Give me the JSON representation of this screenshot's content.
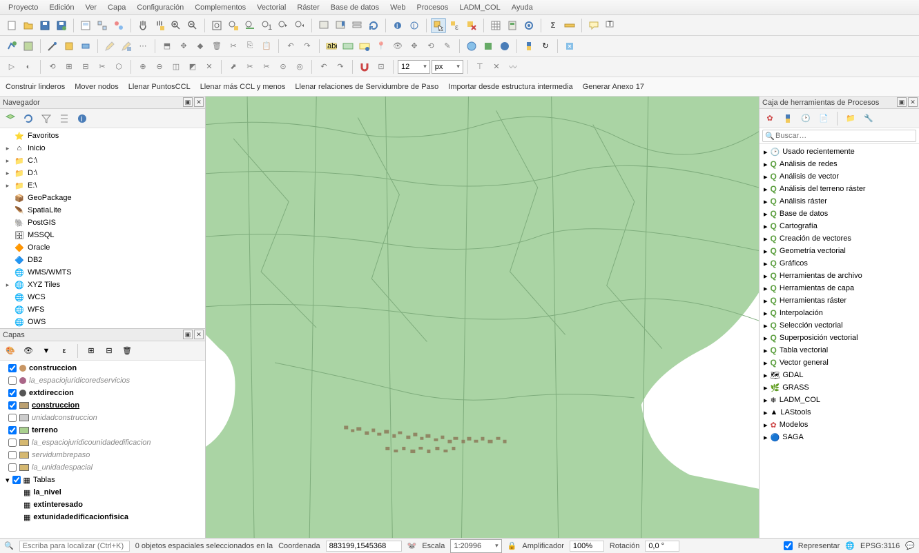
{
  "menu": [
    "Proyecto",
    "Edición",
    "Ver",
    "Capa",
    "Configuración",
    "Complementos",
    "Vectorial",
    "Ráster",
    "Base de datos",
    "Web",
    "Procesos",
    "LADM_COL",
    "Ayuda"
  ],
  "actions": [
    "Construir linderos",
    "Mover nodos",
    "Llenar PuntosCCL",
    "Llenar más CCL y menos",
    "Llenar relaciones de Servidumbre de Paso",
    "Importar desde estructura intermedia",
    "Generar Anexo 17"
  ],
  "snap_value": "12",
  "snap_unit": "px",
  "navegador": {
    "title": "Navegador",
    "items": [
      {
        "label": "Favoritos",
        "icon": "star",
        "color": "#f2c200"
      },
      {
        "label": "Inicio",
        "icon": "home",
        "arrow": true
      },
      {
        "label": "C:\\",
        "icon": "folder",
        "arrow": true
      },
      {
        "label": "D:\\",
        "icon": "folder",
        "arrow": true
      },
      {
        "label": "E:\\",
        "icon": "folder",
        "arrow": true
      },
      {
        "label": "GeoPackage",
        "icon": "geopkg"
      },
      {
        "label": "SpatiaLite",
        "icon": "feather"
      },
      {
        "label": "PostGIS",
        "icon": "elephant"
      },
      {
        "label": "MSSQL",
        "icon": "mssql"
      },
      {
        "label": "Oracle",
        "icon": "oracle"
      },
      {
        "label": "DB2",
        "icon": "db2"
      },
      {
        "label": "WMS/WMTS",
        "icon": "globe"
      },
      {
        "label": "XYZ Tiles",
        "icon": "globe",
        "arrow": true
      },
      {
        "label": "WCS",
        "icon": "globe"
      },
      {
        "label": "WFS",
        "icon": "globe"
      },
      {
        "label": "OWS",
        "icon": "globe"
      }
    ]
  },
  "capas": {
    "title": "Capas",
    "items": [
      {
        "checked": true,
        "label": "construccion",
        "bold": true,
        "swatch": "#c89664",
        "style": "point"
      },
      {
        "checked": false,
        "label": "la_espaciojuridicoredservicios",
        "italic": true,
        "swatch": "#aa6688",
        "style": "point"
      },
      {
        "checked": true,
        "label": "extdireccion",
        "bold": true,
        "swatch": "#555",
        "style": "point"
      },
      {
        "checked": true,
        "label": "construccion",
        "bold": true,
        "underline": true,
        "swatch": "#bba070",
        "style": "square"
      },
      {
        "checked": false,
        "label": "unidadconstruccion",
        "italic": true,
        "swatch": "#ccc",
        "style": "square"
      },
      {
        "checked": true,
        "label": "terreno",
        "bold": true,
        "swatch": "#a9d08e",
        "style": "square"
      },
      {
        "checked": false,
        "label": "la_espaciojuridicounidadedificacion",
        "italic": true,
        "swatch": "#d5b870",
        "style": "square"
      },
      {
        "checked": false,
        "label": "servidumbrepaso",
        "italic": true,
        "swatch": "#d5b870",
        "style": "square"
      },
      {
        "checked": false,
        "label": "la_unidadespacial",
        "italic": true,
        "swatch": "#d5b870",
        "style": "square"
      }
    ],
    "tablas_label": "Tablas",
    "tablas": [
      "la_nivel",
      "extinteresado",
      "extunidadedificacionfisica"
    ]
  },
  "procesos": {
    "title": "Caja de herramientas de Procesos",
    "search_placeholder": "Buscar…",
    "groups": [
      {
        "label": "Usado recientemente",
        "icon": "clock"
      },
      {
        "label": "Análisis de redes",
        "icon": "q"
      },
      {
        "label": "Análisis de vector",
        "icon": "q"
      },
      {
        "label": "Análisis del terreno ráster",
        "icon": "q"
      },
      {
        "label": "Análisis ráster",
        "icon": "q"
      },
      {
        "label": "Base de datos",
        "icon": "q"
      },
      {
        "label": "Cartografía",
        "icon": "q"
      },
      {
        "label": "Creación de vectores",
        "icon": "q"
      },
      {
        "label": "Geometría vectorial",
        "icon": "q"
      },
      {
        "label": "Gráficos",
        "icon": "q"
      },
      {
        "label": "Herramientas de archivo",
        "icon": "q"
      },
      {
        "label": "Herramientas de capa",
        "icon": "q"
      },
      {
        "label": "Herramientas ráster",
        "icon": "q"
      },
      {
        "label": "Interpolación",
        "icon": "q"
      },
      {
        "label": "Selección vectorial",
        "icon": "q"
      },
      {
        "label": "Superposición vectorial",
        "icon": "q"
      },
      {
        "label": "Tabla vectorial",
        "icon": "q"
      },
      {
        "label": "Vector general",
        "icon": "q"
      },
      {
        "label": "GDAL",
        "icon": "gdal"
      },
      {
        "label": "GRASS",
        "icon": "grass"
      },
      {
        "label": "LADM_COL",
        "icon": "ladm"
      },
      {
        "label": "LAStools",
        "icon": "las"
      },
      {
        "label": "Modelos",
        "icon": "gear-red"
      },
      {
        "label": "SAGA",
        "icon": "saga"
      }
    ]
  },
  "status": {
    "locator_placeholder": "Escriba para localizar (Ctrl+K)",
    "selection": "0 objetos espaciales seleccionados en la",
    "coord_label": "Coordenada",
    "coord_value": "883199,1545368",
    "scale_label": "Escala",
    "scale_value": "1:20996",
    "amp_label": "Amplificador",
    "amp_value": "100%",
    "rot_label": "Rotación",
    "rot_value": "0,0 °",
    "render_label": "Representar",
    "crs": "EPSG:3116"
  }
}
